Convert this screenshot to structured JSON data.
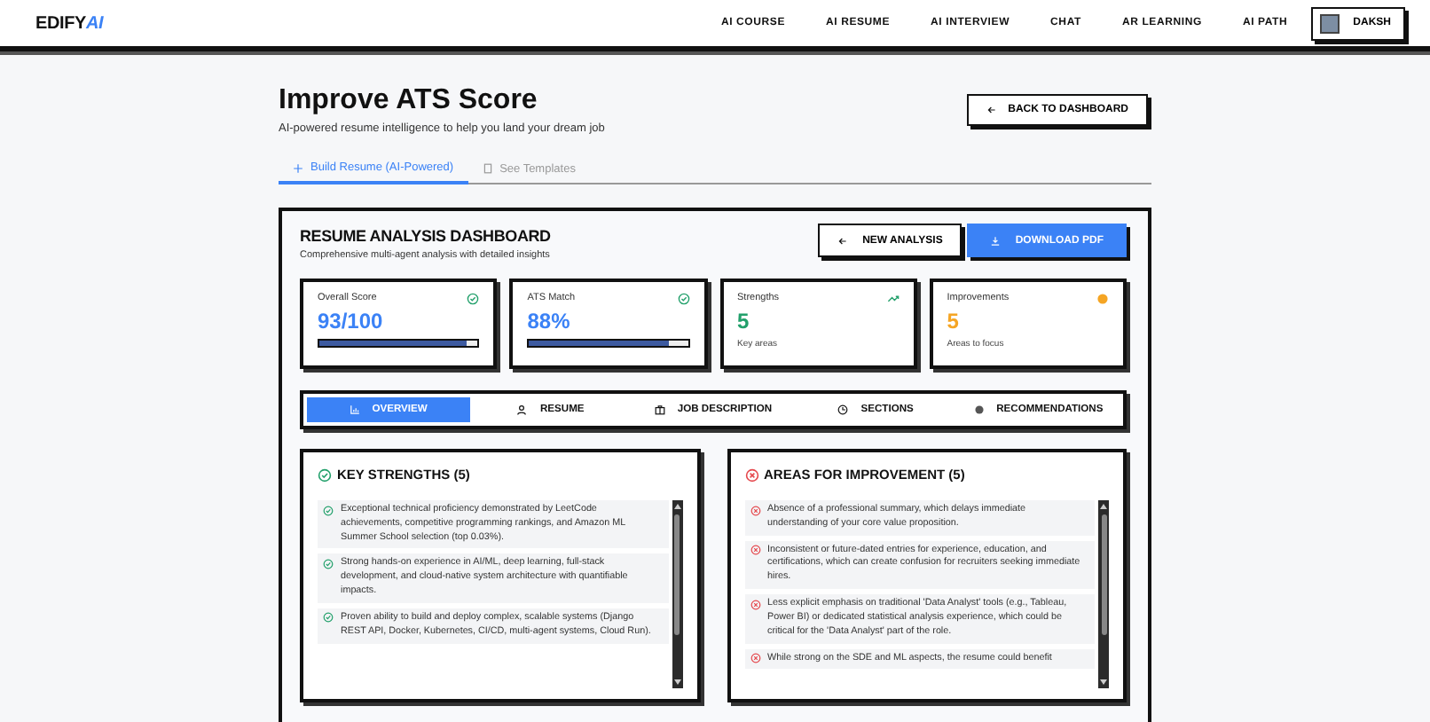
{
  "nav": {
    "logo": "EDIFY",
    "logo_accent": "AI",
    "links": [
      "AI COURSE",
      "AI RESUME",
      "AI INTERVIEW",
      "CHAT",
      "AR LEARNING",
      "AI PATH"
    ],
    "user": "DAKSH"
  },
  "header": {
    "title": "Improve ATS Score",
    "subtitle": "AI-powered resume intelligence to help you land your dream job",
    "back_button": "BACK TO DASHBOARD"
  },
  "page_tabs": [
    {
      "label": "Build Resume (AI-Powered)",
      "selected": true
    },
    {
      "label": "See Templates",
      "selected": false
    }
  ],
  "dashboard": {
    "title": "RESUME ANALYSIS DASHBOARD",
    "subtitle": "Comprehensive multi-agent analysis with detailed insights",
    "new_button": "NEW ANALYSIS",
    "download_button": "DOWNLOAD PDF",
    "stats": [
      {
        "kind": "progress",
        "label": "Overall Score",
        "value": "93/100",
        "level": 0.93,
        "color": "#3b82f6"
      },
      {
        "kind": "progress",
        "label": "ATS Match",
        "value": "88%",
        "level": 0.88,
        "color": "#3b82f6"
      },
      {
        "kind": "trend",
        "label": "Strengths",
        "value": "5",
        "note": "Key areas",
        "color": "#22a06b"
      },
      {
        "kind": "dot",
        "label": "Improvements",
        "value": "5",
        "note": "Areas to focus",
        "color": "#f5a524"
      }
    ],
    "tabs": [
      {
        "label": "OVERVIEW",
        "selected": true
      },
      {
        "label": "RESUME",
        "selected": false
      },
      {
        "label": "JOB DESCRIPTION",
        "selected": false
      },
      {
        "label": "SECTIONS",
        "selected": false
      },
      {
        "label": "RECOMMENDATIONS",
        "selected": false
      }
    ],
    "panels": [
      {
        "kind": "good",
        "title": "KEY STRENGTHS (5)",
        "items": [
          "Exceptional technical proficiency demonstrated by LeetCode achievements, competitive programming rankings, and Amazon ML Summer School selection (top 0.03%).",
          "Strong hands-on experience in AI/ML, deep learning, full-stack development, and cloud-native system architecture with quantifiable impacts.",
          "Proven ability to build and deploy complex, scalable systems (Django REST API, Docker, Kubernetes, CI/CD, multi-agent systems, Cloud Run)."
        ]
      },
      {
        "kind": "bad",
        "title": "AREAS FOR IMPROVEMENT (5)",
        "items": [
          "Absence of a professional summary, which delays immediate understanding of your core value proposition.",
          "Inconsistent or future-dated entries for experience, education, and certifications, which can create confusion for recruiters seeking immediate hires.",
          "Less explicit emphasis on traditional 'Data Analyst' tools (e.g., Tableau, Power BI) or dedicated statistical analysis experience, which could be critical for the 'Data Analyst' part of the role.",
          "While strong on the SDE and ML aspects, the resume could benefit"
        ]
      }
    ]
  }
}
